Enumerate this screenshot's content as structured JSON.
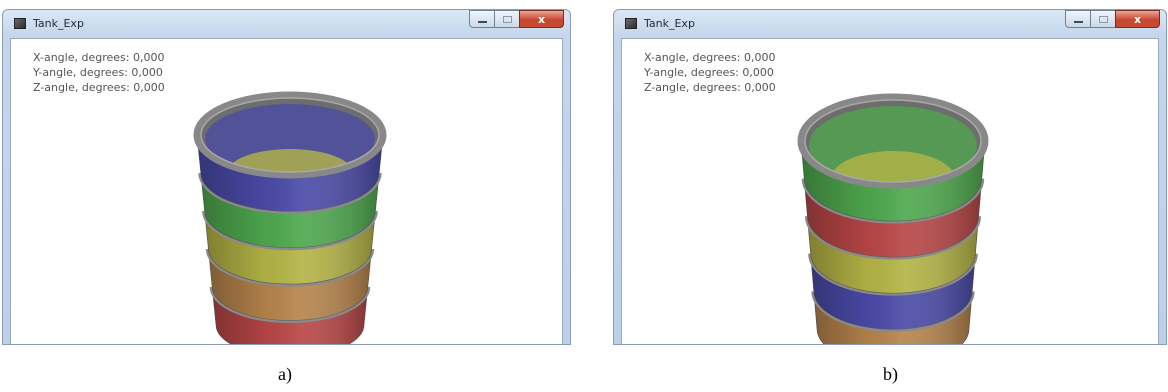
{
  "windows": [
    {
      "title": "Tank_Exp",
      "close_glyph": "x",
      "readout": {
        "x": "X-angle, degrees: 0,000",
        "y": "Y-angle, degrees: 0,000",
        "z": "Z-angle, degrees: 0,000"
      },
      "band_colors": [
        "#4a4aa8",
        "#4ea84e",
        "#b4b446",
        "#b6844c",
        "#b84646"
      ],
      "caption": "a)"
    },
    {
      "title": "Tank_Exp",
      "close_glyph": "x",
      "readout": {
        "x": "X-angle, degrees: 0,000",
        "y": "Y-angle, degrees: 0,000",
        "z": "Z-angle, degrees: 0,000"
      },
      "band_colors": [
        "#4ea84e",
        "#b84646",
        "#b4b446",
        "#4a4aa8",
        "#b6844c"
      ],
      "caption": "b)"
    }
  ],
  "colors": {
    "rim": "#888888",
    "ring": "#8a8a8a",
    "window_frame": "#c4d6ec",
    "close_button": "#c9462e"
  }
}
